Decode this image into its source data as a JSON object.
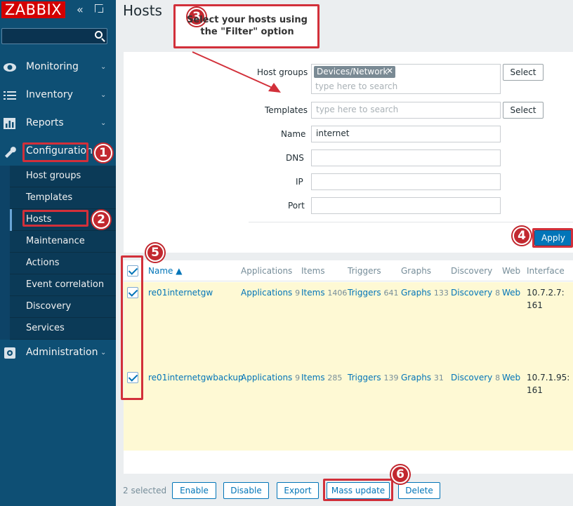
{
  "brand": {
    "logo": "ZABBIX",
    "color": "#d40000"
  },
  "sidebar": {
    "search_placeholder": "",
    "menu": [
      {
        "label": "Monitoring",
        "icon": "eye-icon"
      },
      {
        "label": "Inventory",
        "icon": "list-icon"
      },
      {
        "label": "Reports",
        "icon": "bar-chart-icon"
      },
      {
        "label": "Configuration",
        "icon": "wrench-icon"
      },
      {
        "label": "Administration",
        "icon": "gear-icon"
      }
    ],
    "submenu": [
      "Host groups",
      "Templates",
      "Hosts",
      "Maintenance",
      "Actions",
      "Event correlation",
      "Discovery",
      "Services"
    ]
  },
  "page": {
    "title": "Hosts"
  },
  "filter": {
    "host_groups_label": "Host groups",
    "host_group_tag": "Devices/Network",
    "host_groups_placeholder": "type here to search",
    "templates_label": "Templates",
    "templates_placeholder": "type here to search",
    "name_label": "Name",
    "name_value": "internet",
    "dns_label": "DNS",
    "ip_label": "IP",
    "port_label": "Port",
    "select_label": "Select",
    "apply_label": "Apply"
  },
  "table": {
    "headers": [
      "Name ▲",
      "Applications",
      "Items",
      "Triggers",
      "Graphs",
      "Discovery",
      "Web",
      "Interface"
    ],
    "rows": [
      {
        "name": "re01internetgw",
        "applications": "Applications",
        "applications_count": "9",
        "items": "Items",
        "items_count": "1406",
        "triggers": "Triggers",
        "triggers_count": "641",
        "graphs": "Graphs",
        "graphs_count": "133",
        "discovery": "Discovery",
        "discovery_count": "8",
        "web": "Web",
        "interface_line1": "10.7.2.7:",
        "interface_line2": "161"
      },
      {
        "name": "re01internetgwbackup",
        "applications": "Applications",
        "applications_count": "9",
        "items": "Items",
        "items_count": "285",
        "triggers": "Triggers",
        "triggers_count": "139",
        "graphs": "Graphs",
        "graphs_count": "31",
        "discovery": "Discovery",
        "discovery_count": "8",
        "web": "Web",
        "interface_line1": "10.7.1.95:",
        "interface_line2": "161"
      }
    ]
  },
  "footer": {
    "selected": "2 selected",
    "buttons": [
      "Enable",
      "Disable",
      "Export",
      "Mass update",
      "Delete"
    ]
  },
  "annotations": {
    "callout": "Select your hosts using the \"Filter\" option",
    "numbers": [
      "1",
      "2",
      "3",
      "4",
      "5",
      "6"
    ]
  }
}
